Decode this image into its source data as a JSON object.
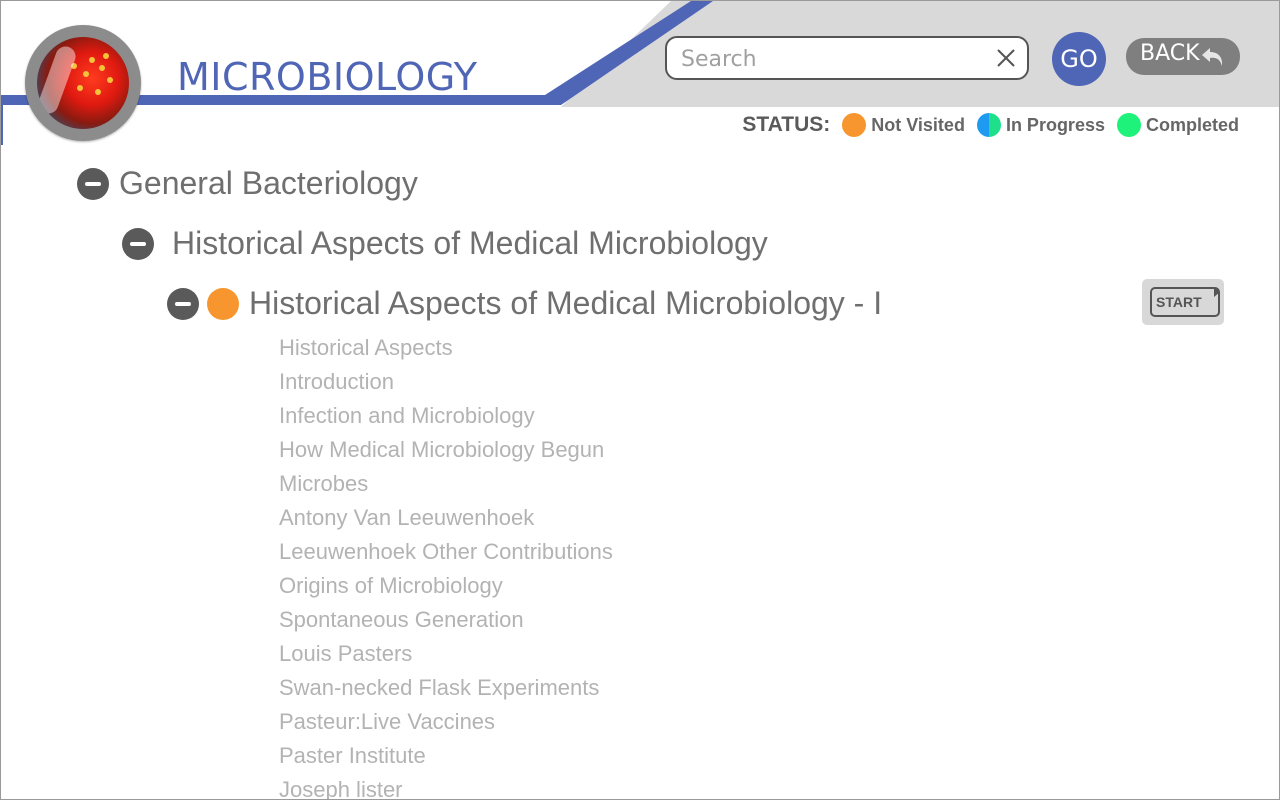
{
  "app": {
    "title": "MICROBIOLOGY",
    "logo_icon": "petri-dish-icon"
  },
  "header": {
    "search": {
      "placeholder": "Search",
      "value": ""
    },
    "go_label": "GO",
    "back_label": "BACK"
  },
  "status_legend": {
    "label": "STATUS:",
    "items": [
      {
        "text": "Not Visited",
        "color": "#f7962e"
      },
      {
        "text": "In Progress",
        "color_left": "#1e9bf0",
        "color_right": "#1ee08a"
      },
      {
        "text": "Completed",
        "color": "#1ef27a"
      }
    ]
  },
  "colors": {
    "accent": "#4f65b5",
    "header_gray": "#d9d9d9",
    "not_visited": "#f7962e"
  },
  "tree": {
    "level1": {
      "label": "General Bacteriology",
      "expanded": true
    },
    "level2": {
      "label": "Historical Aspects of Medical Microbiology",
      "expanded": true
    },
    "level3": {
      "label": "Historical Aspects of Medical Microbiology - I",
      "expanded": true,
      "status": "Not Visited",
      "start_label": "START"
    },
    "topics": [
      "Historical Aspects",
      "Introduction",
      "Infection and Microbiology",
      "How Medical Microbiology Begun",
      "Microbes",
      "Antony Van Leeuwenhoek",
      "Leeuwenhoek Other Contributions",
      "Origins of Microbiology",
      "Spontaneous Generation",
      "Louis Pasters",
      "Swan-necked Flask Experiments",
      "Pasteur:Live Vaccines",
      "Paster Institute",
      "Joseph lister"
    ]
  }
}
